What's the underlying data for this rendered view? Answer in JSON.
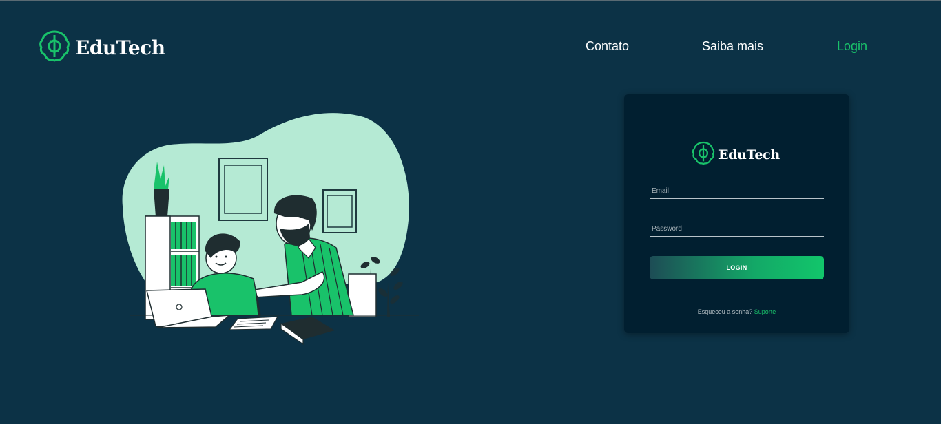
{
  "header": {
    "brand": "EduTech",
    "nav": {
      "contato": "Contato",
      "saiba_mais": "Saiba mais",
      "login": "Login"
    }
  },
  "login_card": {
    "brand": "EduTech",
    "email_placeholder": "Email",
    "password_placeholder": "Password",
    "login_button": "LOGIN",
    "forgot_text": "Esqueceu a senha?",
    "support_link": "Suporte"
  },
  "colors": {
    "background": "#0c3246",
    "card": "#011f30",
    "accent": "#19c26a",
    "illustration_blob": "#b5ead4"
  },
  "icons": {
    "logo": "brain-gear-icon"
  }
}
